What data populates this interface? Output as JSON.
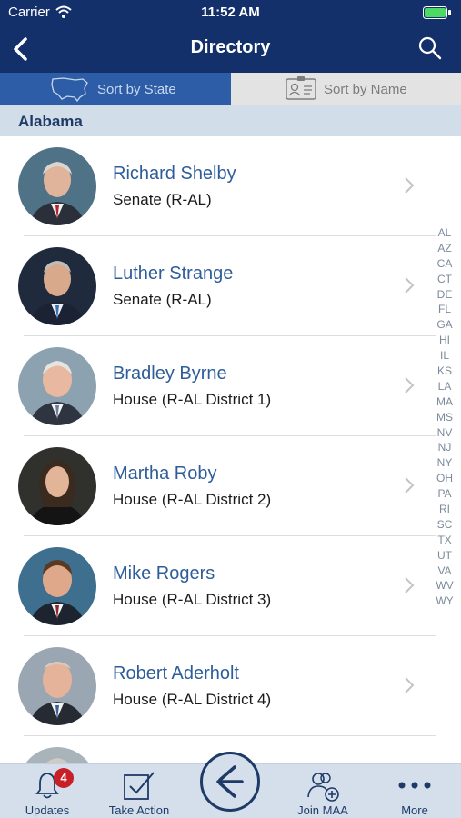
{
  "status": {
    "carrier": "Carrier",
    "time": "11:52 AM"
  },
  "nav": {
    "title": "Directory"
  },
  "sort": {
    "by_state": "Sort by State",
    "by_name": "Sort by Name"
  },
  "section": {
    "title": "Alabama"
  },
  "members": [
    {
      "name": "Richard Shelby",
      "role": "Senate (R-AL)"
    },
    {
      "name": "Luther Strange",
      "role": "Senate (R-AL)"
    },
    {
      "name": "Bradley Byrne",
      "role": "House (R-AL District 1)"
    },
    {
      "name": "Martha Roby",
      "role": "House (R-AL District 2)"
    },
    {
      "name": "Mike Rogers",
      "role": "House (R-AL District 3)"
    },
    {
      "name": "Robert Aderholt",
      "role": "House (R-AL District 4)"
    }
  ],
  "az_index": [
    "AL",
    "AZ",
    "CA",
    "CT",
    "DE",
    "FL",
    "GA",
    "HI",
    "IL",
    "KS",
    "LA",
    "MA",
    "MS",
    "NV",
    "NJ",
    "NY",
    "OH",
    "PA",
    "RI",
    "SC",
    "TX",
    "UT",
    "VA",
    "WV",
    "WY"
  ],
  "tabs": {
    "updates": "Updates",
    "updates_badge": "4",
    "take_action": "Take Action",
    "join": "Join MAA",
    "more": "More"
  },
  "colors": {
    "nav_bg": "#14306b",
    "accent": "#2d5da7",
    "name_text": "#2e5d9a",
    "badge": "#c72026"
  }
}
